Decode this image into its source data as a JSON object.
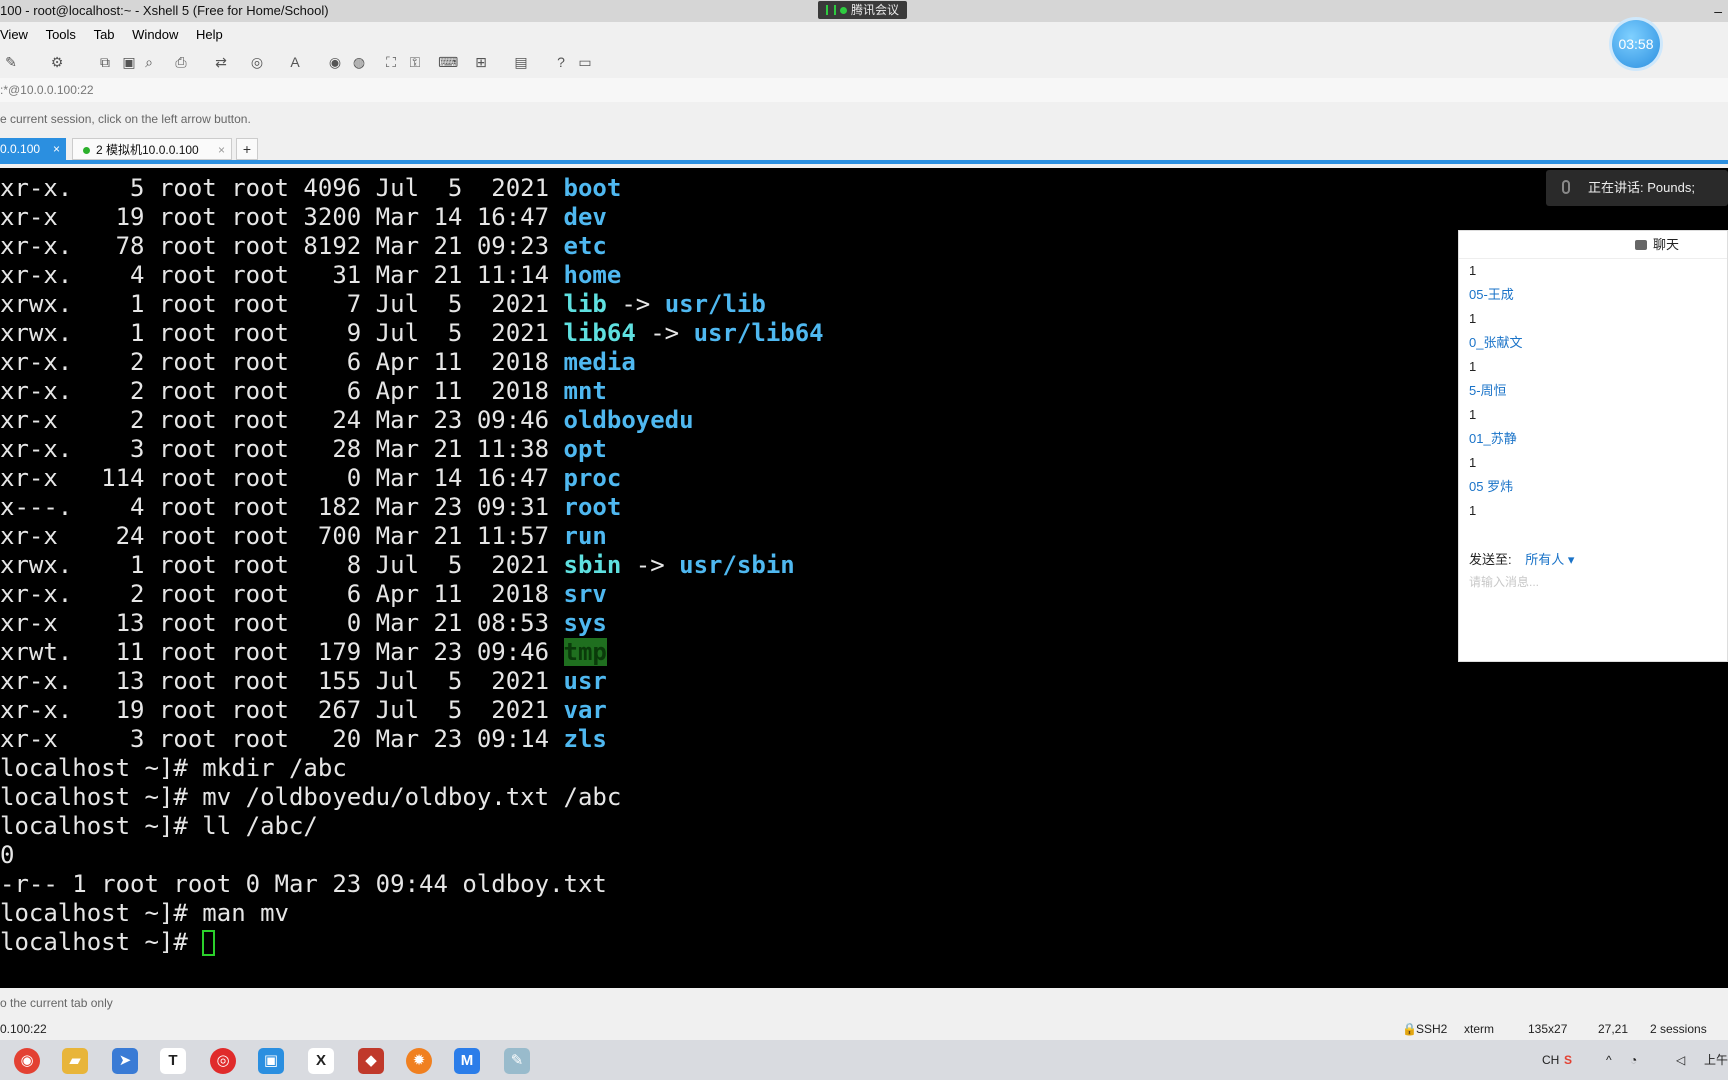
{
  "window": {
    "title": "100 - root@localhost:~ - Xshell 5 (Free for Home/School)",
    "meeting_label": "腾讯会议",
    "minimize": "–"
  },
  "menu": [
    "View",
    "Tools",
    "Tab",
    "Window",
    "Help"
  ],
  "timer": "03:58",
  "address": ":*@10.0.0.100:22",
  "hint": "e current session, click on the left arrow button.",
  "tabs": {
    "tab1_label": "0.0.100",
    "tab2_label": "2 模拟机10.0.0.100",
    "close": "×",
    "add": "+"
  },
  "terminal": {
    "lines": [
      {
        "perm": "xr-x.",
        "links": "5",
        "owner": "root",
        "group": "root",
        "size": "4096",
        "date": "Jul  5  2021",
        "name": "boot",
        "type": "dir"
      },
      {
        "perm": "xr-x ",
        "links": "19",
        "owner": "root",
        "group": "root",
        "size": "3200",
        "date": "Mar 14 16:47",
        "name": "dev",
        "type": "dir"
      },
      {
        "perm": "xr-x.",
        "links": "78",
        "owner": "root",
        "group": "root",
        "size": "8192",
        "date": "Mar 21 09:23",
        "name": "etc",
        "type": "dir"
      },
      {
        "perm": "xr-x.",
        "links": "4",
        "owner": "root",
        "group": "root",
        "size": "31",
        "date": "Mar 21 11:14",
        "name": "home",
        "type": "dir"
      },
      {
        "perm": "xrwx.",
        "links": "1",
        "owner": "root",
        "group": "root",
        "size": "7",
        "date": "Jul  5  2021",
        "name": "lib",
        "type": "link",
        "target": "usr/lib"
      },
      {
        "perm": "xrwx.",
        "links": "1",
        "owner": "root",
        "group": "root",
        "size": "9",
        "date": "Jul  5  2021",
        "name": "lib64",
        "type": "link",
        "target": "usr/lib64"
      },
      {
        "perm": "xr-x.",
        "links": "2",
        "owner": "root",
        "group": "root",
        "size": "6",
        "date": "Apr 11  2018",
        "name": "media",
        "type": "dir"
      },
      {
        "perm": "xr-x.",
        "links": "2",
        "owner": "root",
        "group": "root",
        "size": "6",
        "date": "Apr 11  2018",
        "name": "mnt",
        "type": "dir"
      },
      {
        "perm": "xr-x ",
        "links": "2",
        "owner": "root",
        "group": "root",
        "size": "24",
        "date": "Mar 23 09:46",
        "name": "oldboyedu",
        "type": "dir"
      },
      {
        "perm": "xr-x.",
        "links": "3",
        "owner": "root",
        "group": "root",
        "size": "28",
        "date": "Mar 21 11:38",
        "name": "opt",
        "type": "dir"
      },
      {
        "perm": "xr-x ",
        "links": "114",
        "owner": "root",
        "group": "root",
        "size": "0",
        "date": "Mar 14 16:47",
        "name": "proc",
        "type": "dir"
      },
      {
        "perm": "x---.",
        "links": "4",
        "owner": "root",
        "group": "root",
        "size": "182",
        "date": "Mar 23 09:31",
        "name": "root",
        "type": "dir"
      },
      {
        "perm": "xr-x ",
        "links": "24",
        "owner": "root",
        "group": "root",
        "size": "700",
        "date": "Mar 21 11:57",
        "name": "run",
        "type": "dir"
      },
      {
        "perm": "xrwx.",
        "links": "1",
        "owner": "root",
        "group": "root",
        "size": "8",
        "date": "Jul  5  2021",
        "name": "sbin",
        "type": "link",
        "target": "usr/sbin"
      },
      {
        "perm": "xr-x.",
        "links": "2",
        "owner": "root",
        "group": "root",
        "size": "6",
        "date": "Apr 11  2018",
        "name": "srv",
        "type": "dir"
      },
      {
        "perm": "xr-x ",
        "links": "13",
        "owner": "root",
        "group": "root",
        "size": "0",
        "date": "Mar 21 08:53",
        "name": "sys",
        "type": "dir"
      },
      {
        "perm": "xrwt.",
        "links": "11",
        "owner": "root",
        "group": "root",
        "size": "179",
        "date": "Mar 23 09:46",
        "name": "tmp",
        "type": "sticky"
      },
      {
        "perm": "xr-x.",
        "links": "13",
        "owner": "root",
        "group": "root",
        "size": "155",
        "date": "Jul  5  2021",
        "name": "usr",
        "type": "dir"
      },
      {
        "perm": "xr-x.",
        "links": "19",
        "owner": "root",
        "group": "root",
        "size": "267",
        "date": "Jul  5  2021",
        "name": "var",
        "type": "dir"
      },
      {
        "perm": "xr-x ",
        "links": "3",
        "owner": "root",
        "group": "root",
        "size": "20",
        "date": "Mar 23 09:14",
        "name": "zls",
        "type": "dir"
      }
    ],
    "commands": [
      "localhost ~]# mkdir /abc",
      "localhost ~]# mv /oldboyedu/oldboy.txt /abc",
      "localhost ~]# ll /abc/",
      "0",
      "-r-- 1 root root 0 Mar 23 09:44 oldboy.txt",
      "localhost ~]# man mv"
    ],
    "prompt": "localhost ~]# "
  },
  "speaking": "正在讲话: Pounds;",
  "chat": {
    "title": "聊天",
    "messages": [
      {
        "text": "1",
        "kind": "num"
      },
      {
        "text": "05-王成",
        "kind": "name"
      },
      {
        "text": "1",
        "kind": "num"
      },
      {
        "text": "0_张献文",
        "kind": "name"
      },
      {
        "text": "1",
        "kind": "num"
      },
      {
        "text": "5-周恒",
        "kind": "name"
      },
      {
        "text": "1",
        "kind": "num"
      },
      {
        "text": "01_苏静",
        "kind": "name"
      },
      {
        "text": "1",
        "kind": "num"
      },
      {
        "text": "05 罗炜",
        "kind": "name"
      },
      {
        "text": "1",
        "kind": "num"
      }
    ],
    "send_to_label": "发送至:",
    "send_to_value": "所有人",
    "input_placeholder": "请输入消息..."
  },
  "status": {
    "hint": "o the current tab only",
    "host": "0.100:22",
    "protocol": "SSH2",
    "term": "xterm",
    "size": "135x27",
    "cursor": "27,21",
    "sessions": "2 sessions"
  },
  "tray": {
    "ime": "CH",
    "clock": "上午"
  },
  "colors": {
    "accent": "#2b8fe0",
    "dir": "#4fb8f0",
    "link": "#5fe0e0",
    "terminal_bg": "#000000"
  }
}
